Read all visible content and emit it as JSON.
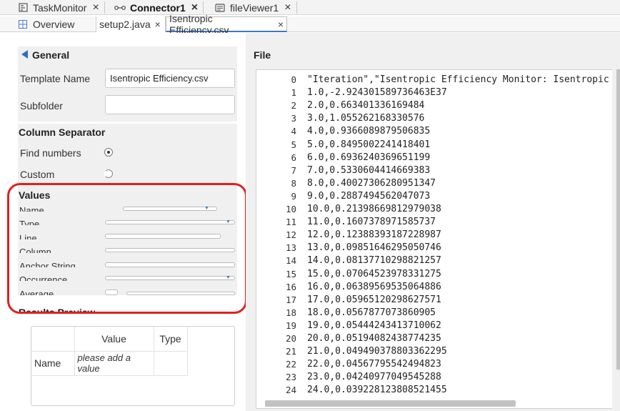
{
  "tabs_top": [
    {
      "label": "TaskMonitor",
      "icon": "task-icon"
    },
    {
      "label": "Connector1",
      "icon": "connector-icon",
      "active": true
    },
    {
      "label": "fileViewer1",
      "icon": "document-icon"
    }
  ],
  "tabs_sub": [
    {
      "label": "Overview",
      "icon": "grid-icon"
    },
    {
      "label": "setup2.java"
    },
    {
      "label": "Isentropic Efficiency.csv",
      "active": true
    }
  ],
  "general": {
    "title": "General",
    "template_name_label": "Template Name",
    "template_name_value": "Isentropic Efficiency.csv",
    "subfolder_label": "Subfolder",
    "subfolder_value": ""
  },
  "column_separator": {
    "title": "Column Separator",
    "find_numbers_label": "Find numbers",
    "custom_label": "Custom",
    "selected": "Find numbers"
  },
  "values": {
    "title": "Values",
    "fields": [
      "Name",
      "Type",
      "Line",
      "Column",
      "Anchor String",
      "Occurrence",
      "Average"
    ]
  },
  "results_preview": {
    "title": "Results Preview",
    "col_value": "Value",
    "col_type": "Type",
    "row_name": "Name",
    "row_value": "please add a value",
    "row_type": ""
  },
  "file": {
    "title": "File",
    "lines": [
      "\"Iteration\",\"Isentropic Efficiency Monitor: Isentropic",
      "1.0,-2.924301589736463E37",
      "2.0,0.663401336169484",
      "3.0,1.055262168330576",
      "4.0,0.9366089879506835",
      "5.0,0.8495002241418401",
      "6.0,0.6936240369651199",
      "7.0,0.5330604414669383",
      "8.0,0.40027306280951347",
      "9.0,0.2887494562047073",
      "10.0,0.21398669812979038",
      "11.0,0.1607378971585737",
      "12.0,0.12388393187228987",
      "13.0,0.09851646295050746",
      "14.0,0.08137710298821257",
      "15.0,0.07064523978331275",
      "16.0,0.06389569535064886",
      "17.0,0.05965120298627571",
      "18.0,0.0567877073860905",
      "19.0,0.05444243413710062",
      "20.0,0.05194082438774235",
      "21.0,0.049490378803362295",
      "22.0,0.04567795542494823",
      "23.0,0.04240977049545288",
      "24.0,0.039228123808521455"
    ]
  },
  "colors": {
    "accent": "#3a78c8",
    "highlight": "#e02020"
  }
}
